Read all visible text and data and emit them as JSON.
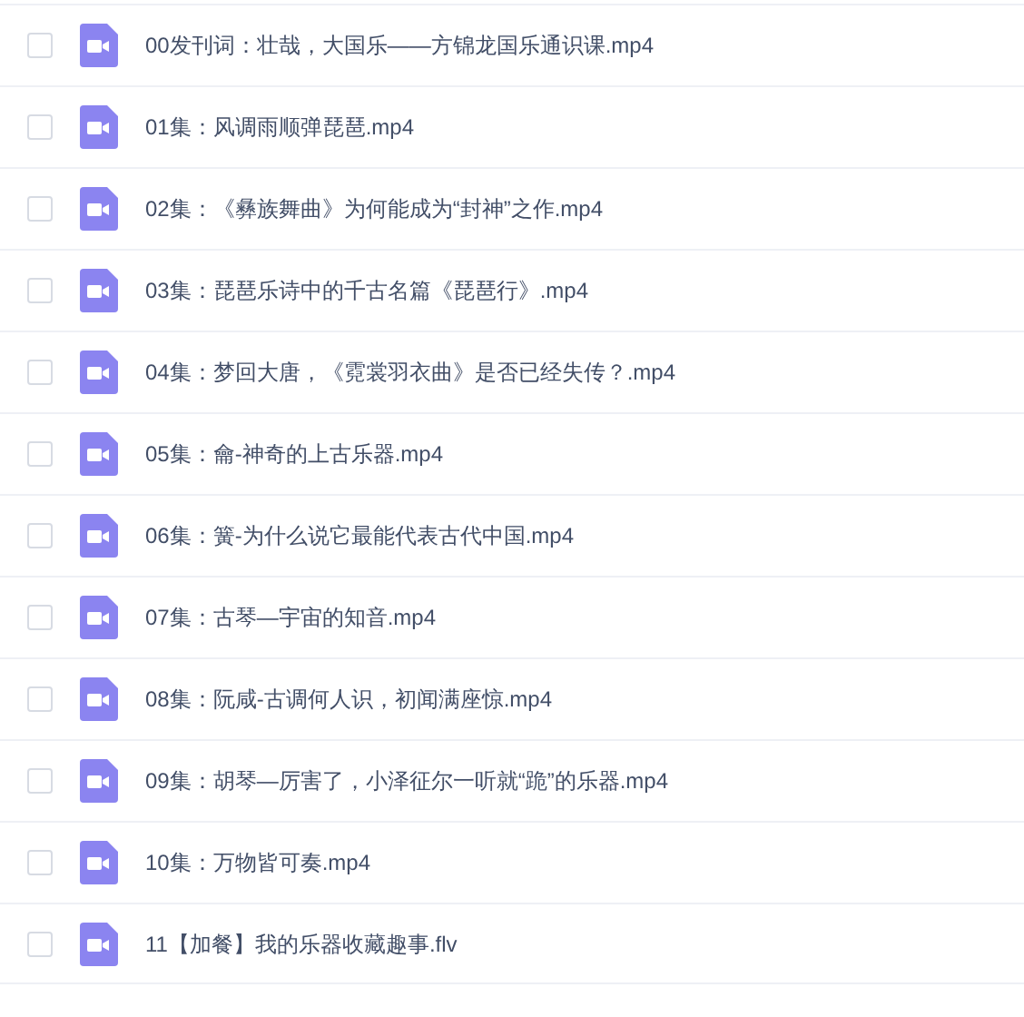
{
  "files": [
    {
      "name": "00发刊词：壮哉，大国乐——方锦龙国乐通识课.mp4",
      "checked": false
    },
    {
      "name": "01集：风调雨顺弹琵琶.mp4",
      "checked": false
    },
    {
      "name": "02集：《彝族舞曲》为何能成为“封神”之作.mp4",
      "checked": false
    },
    {
      "name": "03集：琵琶乐诗中的千古名篇《琵琶行》.mp4",
      "checked": false
    },
    {
      "name": "04集：梦回大唐，《霓裳羽衣曲》是否已经失传？.mp4",
      "checked": false
    },
    {
      "name": "05集：龠-神奇的上古乐器.mp4",
      "checked": false
    },
    {
      "name": "06集：簧-为什么说它最能代表古代中国.mp4",
      "checked": false
    },
    {
      "name": "07集：古琴—宇宙的知音.mp4",
      "checked": false
    },
    {
      "name": "08集：阮咸-古调何人识，初闻满座惊.mp4",
      "checked": false
    },
    {
      "name": "09集：胡琴—厉害了，小泽征尔一听就“跪”的乐器.mp4",
      "checked": false
    },
    {
      "name": "10集：万物皆可奏.mp4",
      "checked": false
    },
    {
      "name": "11【加餐】我的乐器收藏趣事.flv",
      "checked": false
    }
  ]
}
